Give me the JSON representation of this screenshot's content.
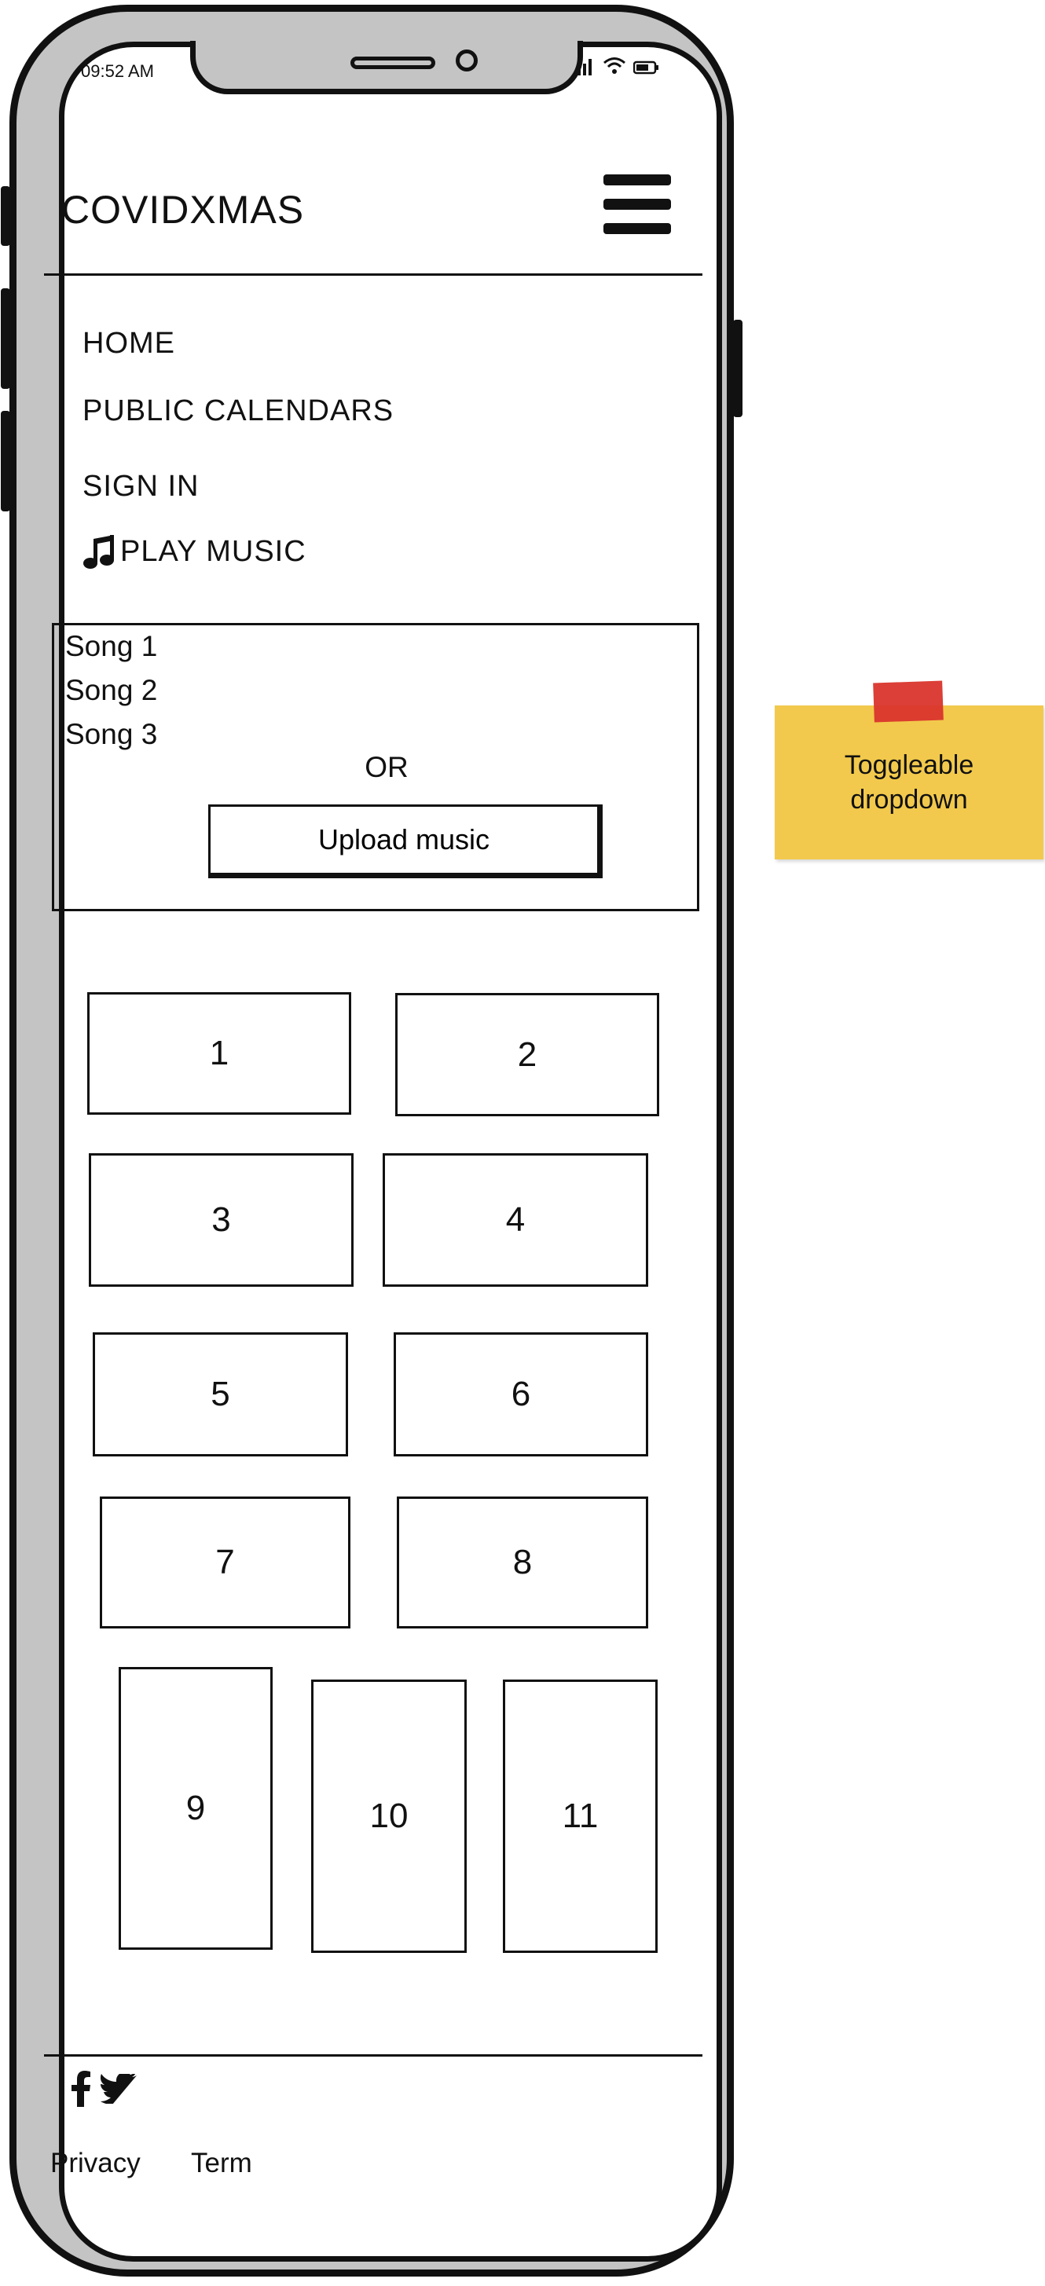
{
  "status_bar": {
    "time": "09:52 AM"
  },
  "header": {
    "brand": "COVIDXMAS"
  },
  "nav": {
    "items": [
      {
        "label": "HOME"
      },
      {
        "label": "PUBLIC CALENDARS"
      },
      {
        "label": "SIGN IN"
      },
      {
        "label": "PLAY MUSIC",
        "icon": "music-note-icon"
      }
    ]
  },
  "music_dropdown": {
    "songs": [
      "Song 1",
      "Song 2",
      "Song 3"
    ],
    "or_label": "OR",
    "upload_label": "Upload music"
  },
  "calendar_tiles": [
    "1",
    "2",
    "3",
    "4",
    "5",
    "6",
    "7",
    "8",
    "9",
    "10",
    "11"
  ],
  "footer": {
    "social_icons": [
      "facebook-icon",
      "twitter-icon"
    ],
    "links": [
      "Privacy",
      "Term"
    ]
  },
  "annotation": {
    "note_line1": "Toggleable",
    "note_line2": "dropdown",
    "note_color": "#f2c94c",
    "tape_color": "#d9352c"
  }
}
